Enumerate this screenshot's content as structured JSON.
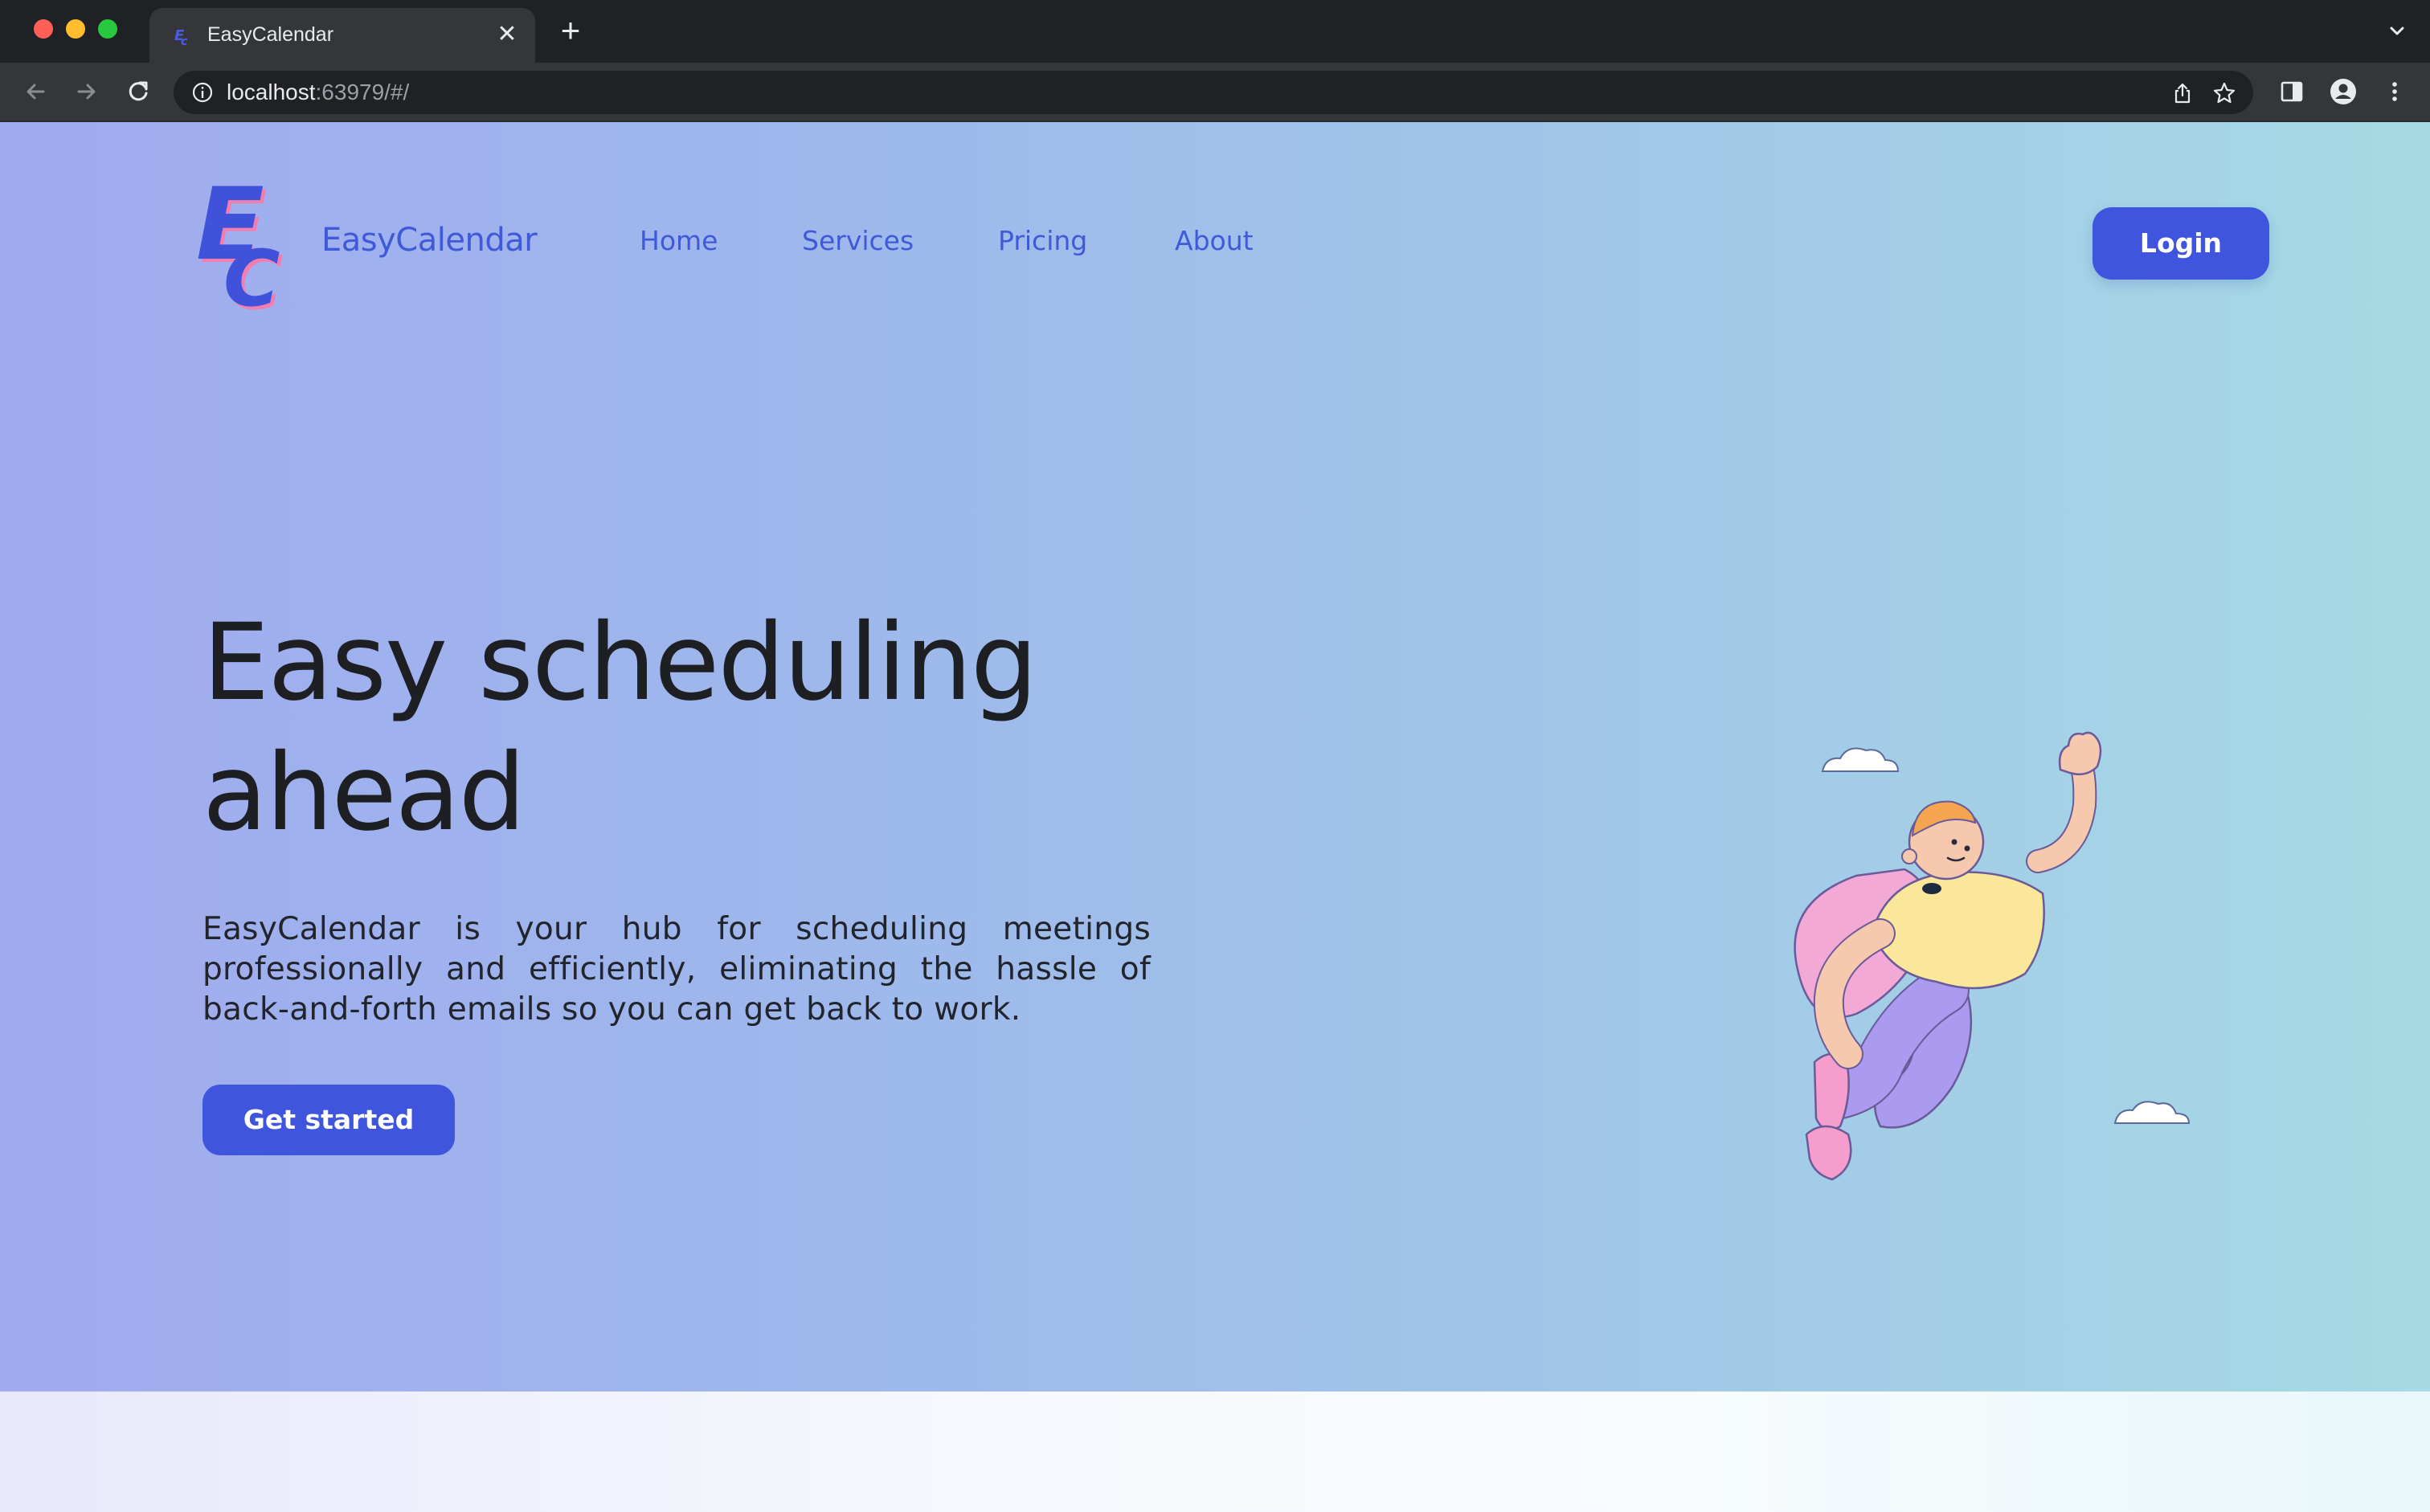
{
  "browser": {
    "tab_title": "EasyCalendar",
    "tab_close_icon": "close-icon",
    "new_tab_icon": "plus-icon",
    "url_host": "localhost",
    "url_rest": ":63979/#/"
  },
  "site": {
    "brand": "EasyCalendar",
    "logo_letters": "EC",
    "nav": {
      "home": "Home",
      "services": "Services",
      "pricing": "Pricing",
      "about": "About"
    },
    "login_label": "Login"
  },
  "hero": {
    "headline": "Easy scheduling ahead",
    "description": "EasyCalendar is your hub for scheduling meetings professionally and efficiently, eliminating the hassle of back-and-forth emails so you can get back to work.",
    "cta_label": "Get started"
  },
  "colors": {
    "accent": "#3f55de",
    "brand_text": "#3f59d8",
    "heading_text": "#1e1f22",
    "logo_accent": "#f27eb0"
  }
}
